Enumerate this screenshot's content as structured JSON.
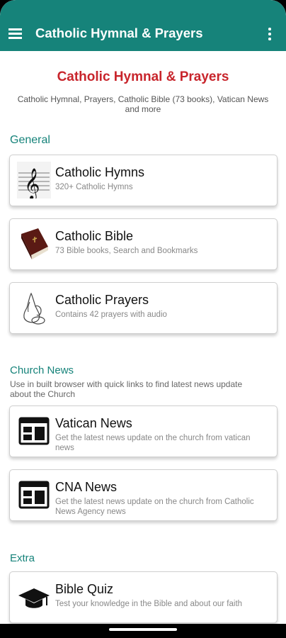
{
  "app": {
    "title": "Catholic Hymnal & Prayers"
  },
  "hero": {
    "title": "Catholic Hymnal & Prayers",
    "subtitle": "Catholic Hymnal, Prayers, Catholic Bible (73 books), Vatican News and more"
  },
  "sections": {
    "general": {
      "heading": "General",
      "cards": [
        {
          "title": "Catholic Hymns",
          "subtitle": "320+ Catholic Hymns",
          "icon": "treble-clef-icon"
        },
        {
          "title": "Catholic Bible",
          "subtitle": "73 Bible books, Search and Bookmarks",
          "icon": "bible-book-icon"
        },
        {
          "title": "Catholic Prayers",
          "subtitle": "Contains 42 prayers with audio",
          "icon": "praying-hands-icon"
        }
      ]
    },
    "news": {
      "heading": "Church News",
      "description": "Use in built browser with quick links  to find latest news update about the Church",
      "cards": [
        {
          "title": "Vatican News",
          "subtitle": "Get the latest news update on the church from vatican news",
          "icon": "newspaper-icon"
        },
        {
          "title": "CNA News",
          "subtitle": "Get the latest news update on the church from Catholic News Agency news",
          "icon": "newspaper-icon"
        }
      ]
    },
    "extra": {
      "heading": "Extra",
      "cards": [
        {
          "title": "Bible Quiz",
          "subtitle": "Test your knowledge in the Bible and about our faith",
          "icon": "graduation-cap-icon"
        }
      ]
    }
  },
  "colors": {
    "primary": "#16837a",
    "accent_title": "#c8252c"
  }
}
